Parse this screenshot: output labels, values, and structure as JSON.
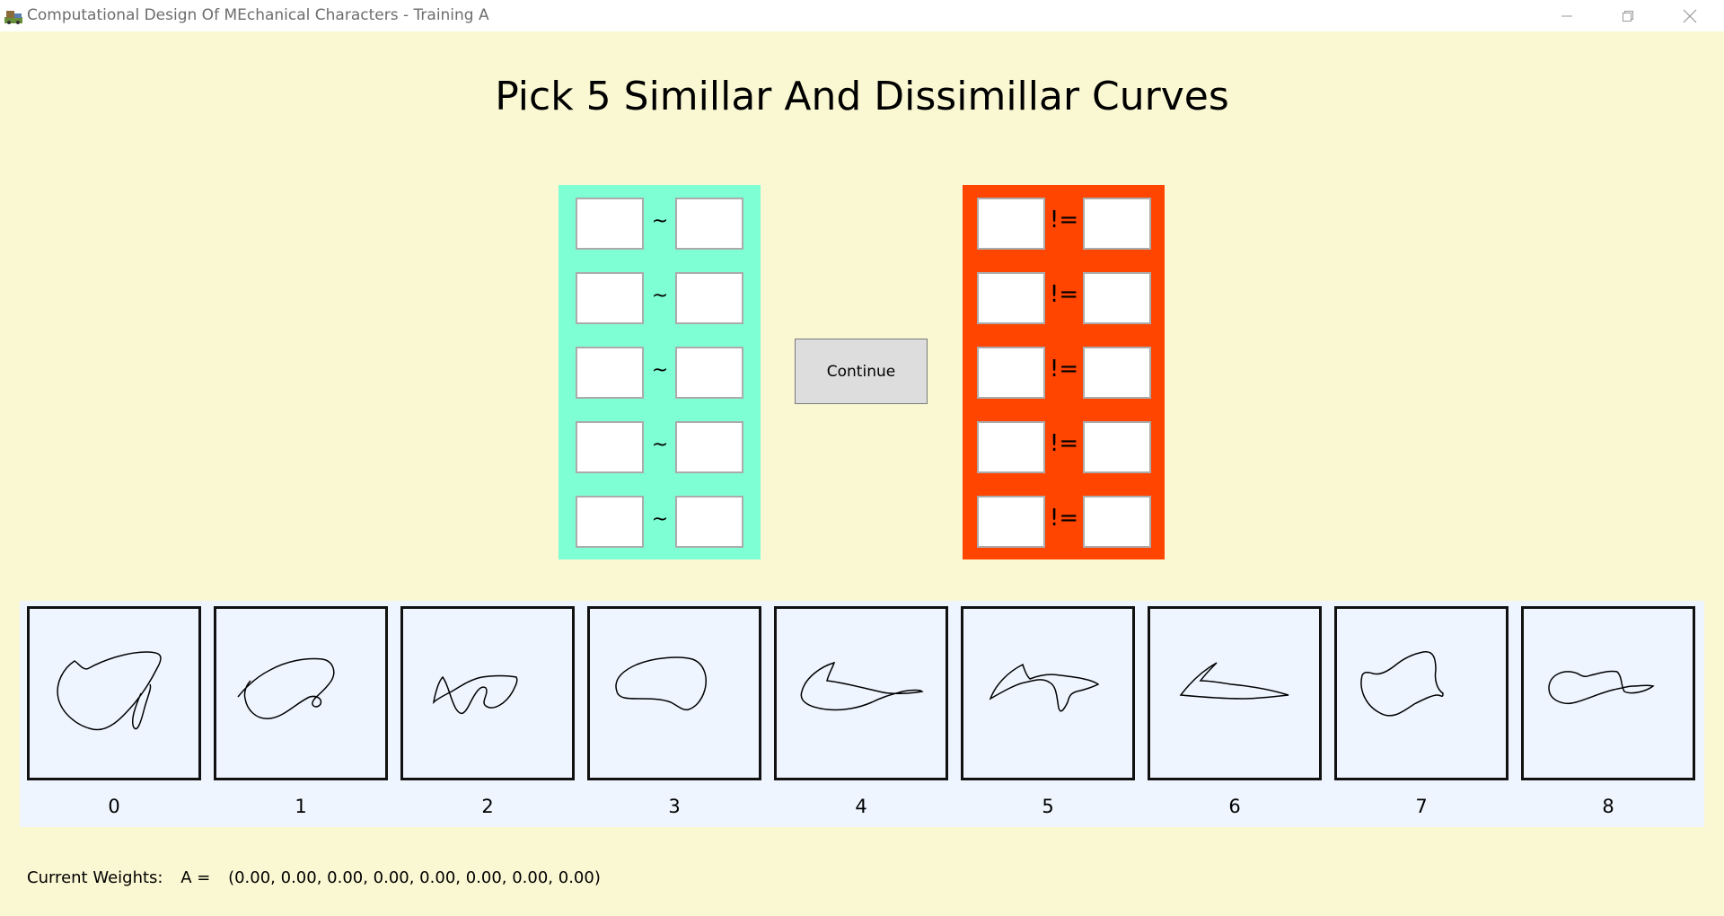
{
  "window": {
    "title": "Computational Design Of MEchanical Characters - Training A",
    "icon": "app-icon"
  },
  "heading": "Pick 5 Simillar And Dissimillar Curves",
  "similar_panel": {
    "color": "#7FFFD4",
    "relation_symbol": "~",
    "rows": [
      {
        "left": "",
        "right": ""
      },
      {
        "left": "",
        "right": ""
      },
      {
        "left": "",
        "right": ""
      },
      {
        "left": "",
        "right": ""
      },
      {
        "left": "",
        "right": ""
      }
    ]
  },
  "dissimilar_panel": {
    "color": "#FF4500",
    "relation_symbol": "!=",
    "rows": [
      {
        "left": "",
        "right": ""
      },
      {
        "left": "",
        "right": ""
      },
      {
        "left": "",
        "right": ""
      },
      {
        "left": "",
        "right": ""
      },
      {
        "left": "",
        "right": ""
      }
    ]
  },
  "continue_button": {
    "label": "Continue"
  },
  "curves": [
    {
      "label": "0"
    },
    {
      "label": "1"
    },
    {
      "label": "2"
    },
    {
      "label": "3"
    },
    {
      "label": "4"
    },
    {
      "label": "5"
    },
    {
      "label": "6"
    },
    {
      "label": "7"
    },
    {
      "label": "8"
    }
  ],
  "weights": {
    "label": "Current Weights:",
    "name": "A =",
    "values": "(0.00, 0.00, 0.00, 0.00, 0.00, 0.00, 0.00, 0.00)"
  }
}
